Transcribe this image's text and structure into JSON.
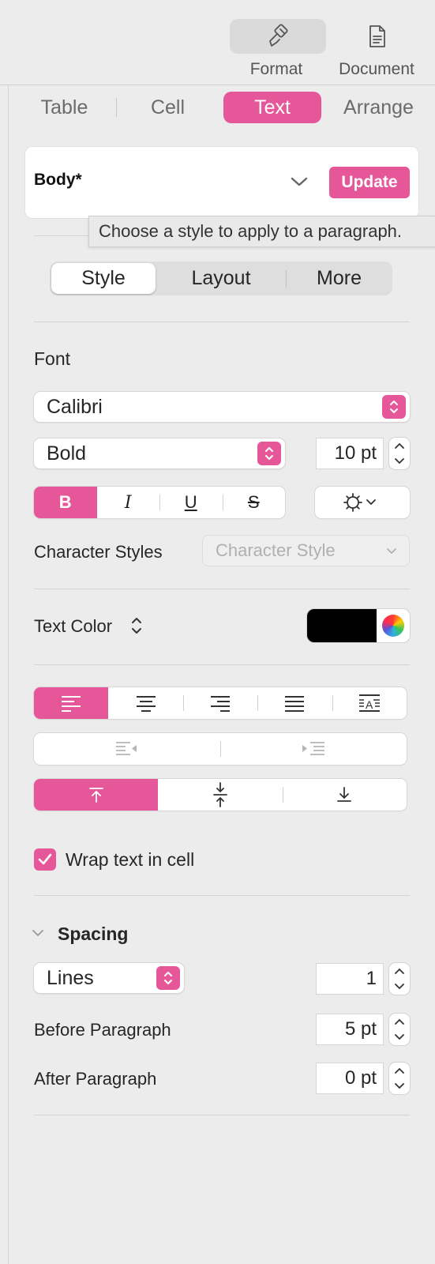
{
  "toolbar": {
    "format_label": "Format",
    "document_label": "Document",
    "format_icon": "paintbrush-icon",
    "document_icon": "document-icon"
  },
  "tabs": [
    {
      "label": "Table",
      "selected": false
    },
    {
      "label": "Cell",
      "selected": false
    },
    {
      "label": "Text",
      "selected": true
    },
    {
      "label": "Arrange",
      "selected": false
    }
  ],
  "paragraph_style": {
    "name": "Body*",
    "update_label": "Update",
    "tooltip": "Choose a style to apply to a paragraph."
  },
  "subtabs": [
    {
      "label": "Style",
      "selected": true
    },
    {
      "label": "Layout",
      "selected": false
    },
    {
      "label": "More",
      "selected": false
    }
  ],
  "font": {
    "heading": "Font",
    "family": "Calibri",
    "typeface": "Bold",
    "size": "10 pt",
    "bold_glyph": "B",
    "italic_glyph": "I",
    "underline_glyph": "U",
    "strike_glyph": "S",
    "bold_active": true
  },
  "character_styles": {
    "label": "Character Styles",
    "placeholder": "Character Style"
  },
  "text_color": {
    "label": "Text Color",
    "swatch": "#000000"
  },
  "alignment": {
    "selected": "left",
    "options": [
      "left",
      "center",
      "right",
      "justify",
      "auto"
    ]
  },
  "vertical_alignment": {
    "selected": "top",
    "options": [
      "top",
      "middle",
      "bottom"
    ]
  },
  "wrap": {
    "label": "Wrap text in cell",
    "checked": true
  },
  "spacing": {
    "heading": "Spacing",
    "line_mode": "Lines",
    "line_value": "1",
    "before_label": "Before Paragraph",
    "before_value": "5 pt",
    "after_label": "After Paragraph",
    "after_value": "0 pt"
  },
  "colors": {
    "accent": "#e6579a",
    "background": "#ececec"
  }
}
